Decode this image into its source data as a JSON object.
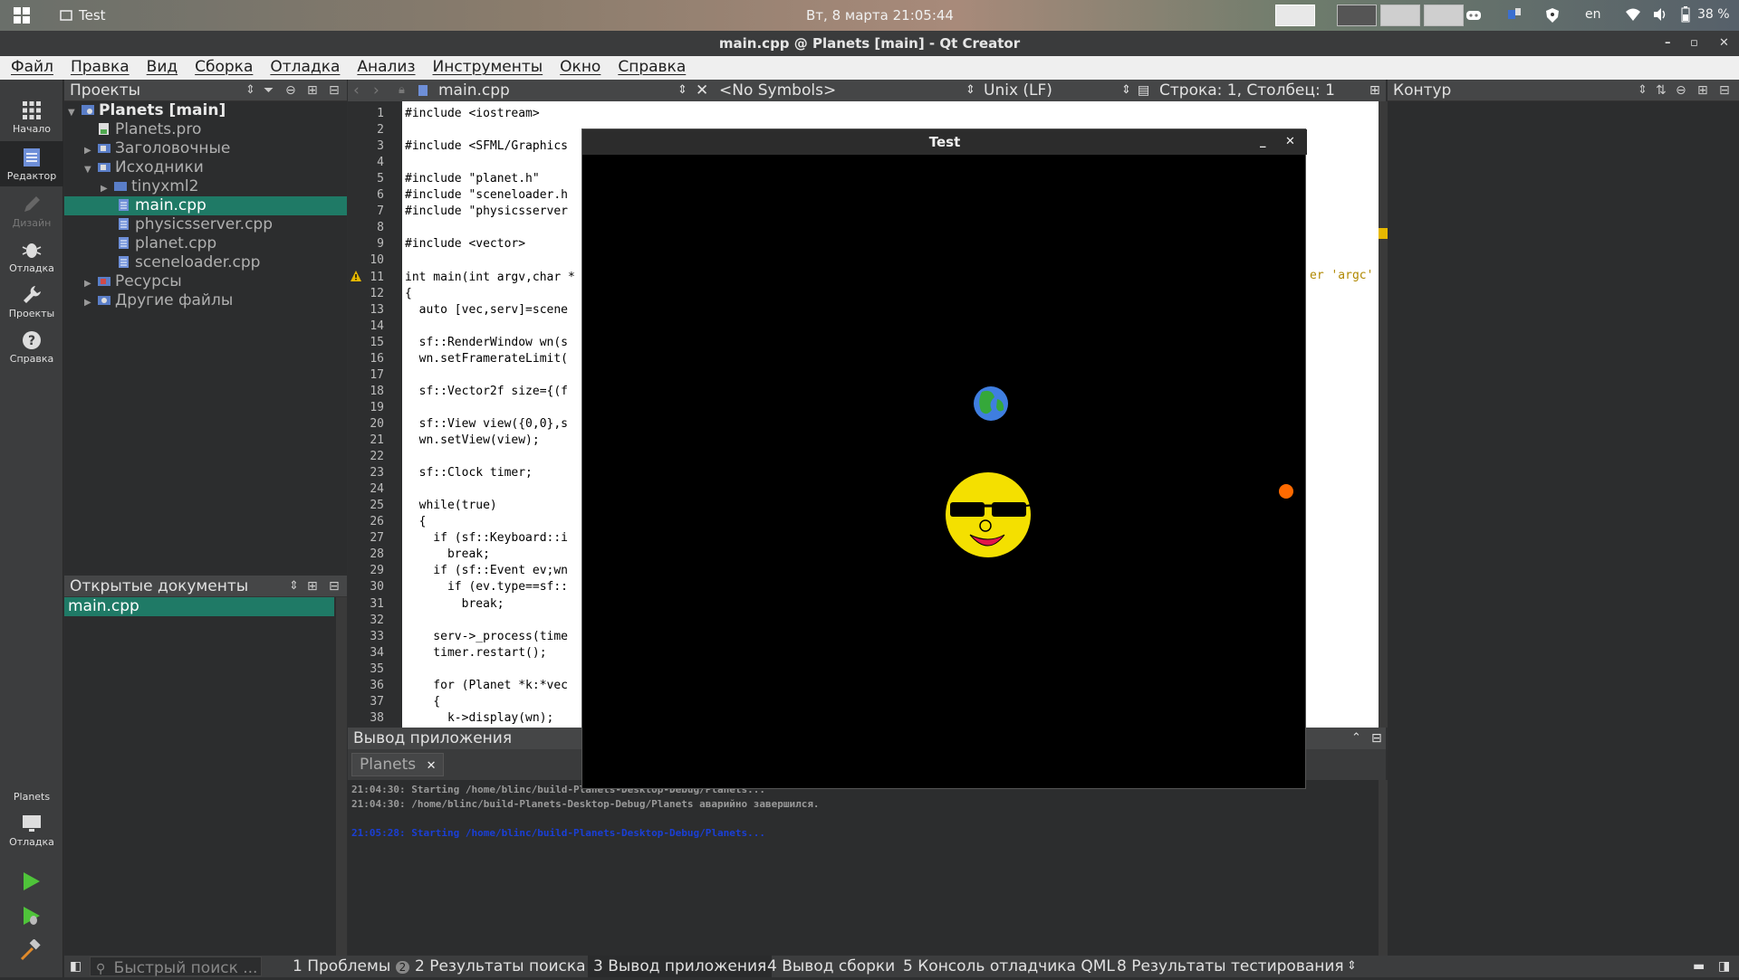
{
  "desktop": {
    "task_label": "Test",
    "clock": "Вт, 8 марта  21:05:44",
    "tray_lang": "en",
    "battery": "38 %"
  },
  "window": {
    "title": "main.cpp @ Planets [main] - Qt Creator"
  },
  "menu": [
    "Файл",
    "Правка",
    "Вид",
    "Сборка",
    "Отладка",
    "Анализ",
    "Инструменты",
    "Окно",
    "Справка"
  ],
  "modes": [
    {
      "label": "Начало",
      "icon": "grid-icon"
    },
    {
      "label": "Редактор",
      "icon": "document-icon"
    },
    {
      "label": "Дизайн",
      "icon": "pencil-icon"
    },
    {
      "label": "Отладка",
      "icon": "bug-icon"
    },
    {
      "label": "Проекты",
      "icon": "wrench-icon"
    },
    {
      "label": "Справка",
      "icon": "help-icon"
    }
  ],
  "kit": {
    "name": "Planets",
    "mode": "Отладка"
  },
  "projects": {
    "title": "Проекты",
    "items": [
      {
        "label": "Planets [main]"
      },
      {
        "label": "Planets.pro"
      },
      {
        "label": "Заголовочные"
      },
      {
        "label": "Исходники"
      },
      {
        "label": "tinyxml2"
      },
      {
        "label": "main.cpp"
      },
      {
        "label": "physicsserver.cpp"
      },
      {
        "label": "planet.cpp"
      },
      {
        "label": "sceneloader.cpp"
      },
      {
        "label": "Ресурсы"
      },
      {
        "label": "Другие файлы"
      }
    ]
  },
  "open_docs": {
    "title": "Открытые документы",
    "items": [
      "main.cpp"
    ]
  },
  "editor": {
    "file": "main.cpp",
    "symbols": "<No Symbols>",
    "line_ending": "Unix (LF)",
    "position": "Строка: 1, Столбец: 1",
    "warning_tail": "er 'argc'",
    "lines": [
      "#include <iostream>",
      "",
      "#include <SFML/Graphics",
      "",
      "#include \"planet.h\"",
      "#include \"sceneloader.h",
      "#include \"physicsserver",
      "",
      "#include <vector>",
      "",
      "int main(int argv,char *",
      "{",
      "  auto [vec,serv]=scene",
      "",
      "  sf::RenderWindow wn(s",
      "  wn.setFramerateLimit(",
      "",
      "  sf::Vector2f size={(f",
      "",
      "  sf::View view({0,0},s",
      "  wn.setView(view);",
      "",
      "  sf::Clock timer;",
      "",
      "  while(true)",
      "  {",
      "    if (sf::Keyboard::i",
      "      break;",
      "    if (sf::Event ev;wn",
      "      if (ev.type==sf::",
      "        break;",
      "",
      "    serv->_process(time",
      "    timer.restart();",
      "",
      "    for (Planet *k:*vec",
      "    {",
      "      k->display(wn);"
    ]
  },
  "outline": {
    "title": "Контур"
  },
  "output": {
    "title": "Вывод приложения",
    "tab": "Planets",
    "lines": [
      "21:04:30: Starting /home/blinc/build-Planets-Desktop-Debug/Planets...",
      "21:04:30: /home/blinc/build-Planets-Desktop-Debug/Planets аварийно завершился.",
      "",
      "21:05:28: Starting /home/blinc/build-Planets-Desktop-Debug/Planets..."
    ]
  },
  "status": {
    "search_placeholder": "Быстрый поиск ...",
    "tabs": [
      {
        "label": "1 Проблемы",
        "badge": "2"
      },
      {
        "label": "2 Результаты поиска"
      },
      {
        "label": "3 Вывод приложения"
      },
      {
        "label": "4 Вывод сборки"
      },
      {
        "label": "5 Консоль отладчика QML"
      },
      {
        "label": "8 Результаты тестирования"
      }
    ]
  },
  "testwindow": {
    "title": "Test"
  },
  "colors": {
    "accent": "#1f7a66",
    "output_blue": "#1a3fd6",
    "warning": "#e6b800"
  }
}
